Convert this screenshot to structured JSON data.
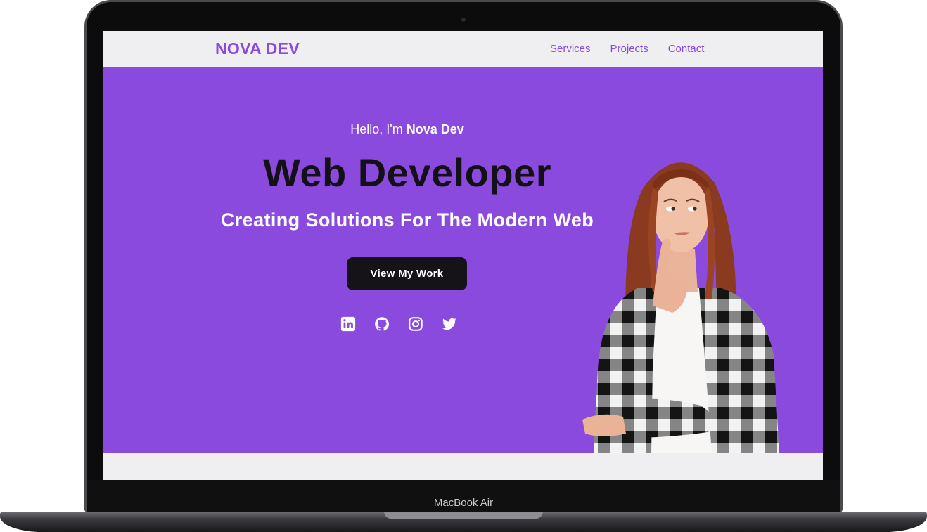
{
  "device": {
    "model_label": "MacBook Air"
  },
  "navbar": {
    "brand": "NOVA DEV",
    "links": [
      {
        "label": "Services"
      },
      {
        "label": "Projects"
      },
      {
        "label": "Contact"
      }
    ]
  },
  "hero": {
    "greeting_prefix": "Hello, I'm ",
    "greeting_name": "Nova Dev",
    "headline": "Web Developer",
    "subheadline": "Creating Solutions For The Modern Web",
    "cta_label": "View My Work",
    "socials": [
      {
        "icon": "linkedin-icon"
      },
      {
        "icon": "github-icon"
      },
      {
        "icon": "instagram-icon"
      },
      {
        "icon": "twitter-icon"
      }
    ]
  },
  "colors": {
    "accent": "#8a4ade",
    "nav_background": "#efeff1",
    "headline": "#141018",
    "button": "#151218",
    "white": "#ffffff"
  }
}
